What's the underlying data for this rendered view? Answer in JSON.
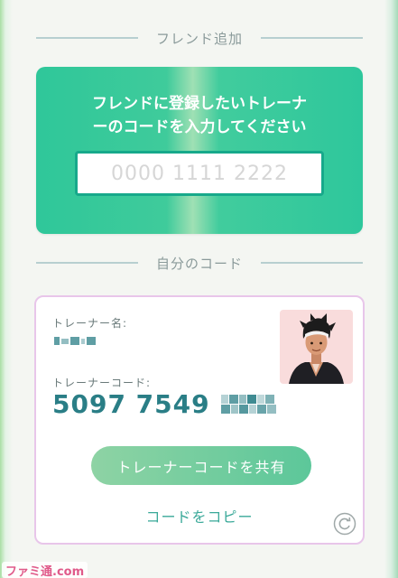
{
  "add_friend": {
    "header": "フレンド追加",
    "prompt_line1": "フレンドに登録したいトレーナ",
    "prompt_line2": "ーのコードを入力してください",
    "input_placeholder": "0000 1111 2222",
    "input_value": ""
  },
  "my_code": {
    "header": "自分のコード",
    "name_label": "トレーナー名:",
    "code_label": "トレーナーコード:",
    "code_visible": "5097 7549",
    "share_button": "トレーナーコードを共有",
    "copy_link": "コードをコピー",
    "icons": {
      "refresh": "refresh-icon",
      "avatar": "trainer-avatar"
    }
  },
  "watermark": "ファミ通.com",
  "colors": {
    "accent_green": "#2fc79a",
    "code_teal": "#2a7e86",
    "card_border_pink": "#e8c6ea",
    "input_border": "#17a98b"
  }
}
